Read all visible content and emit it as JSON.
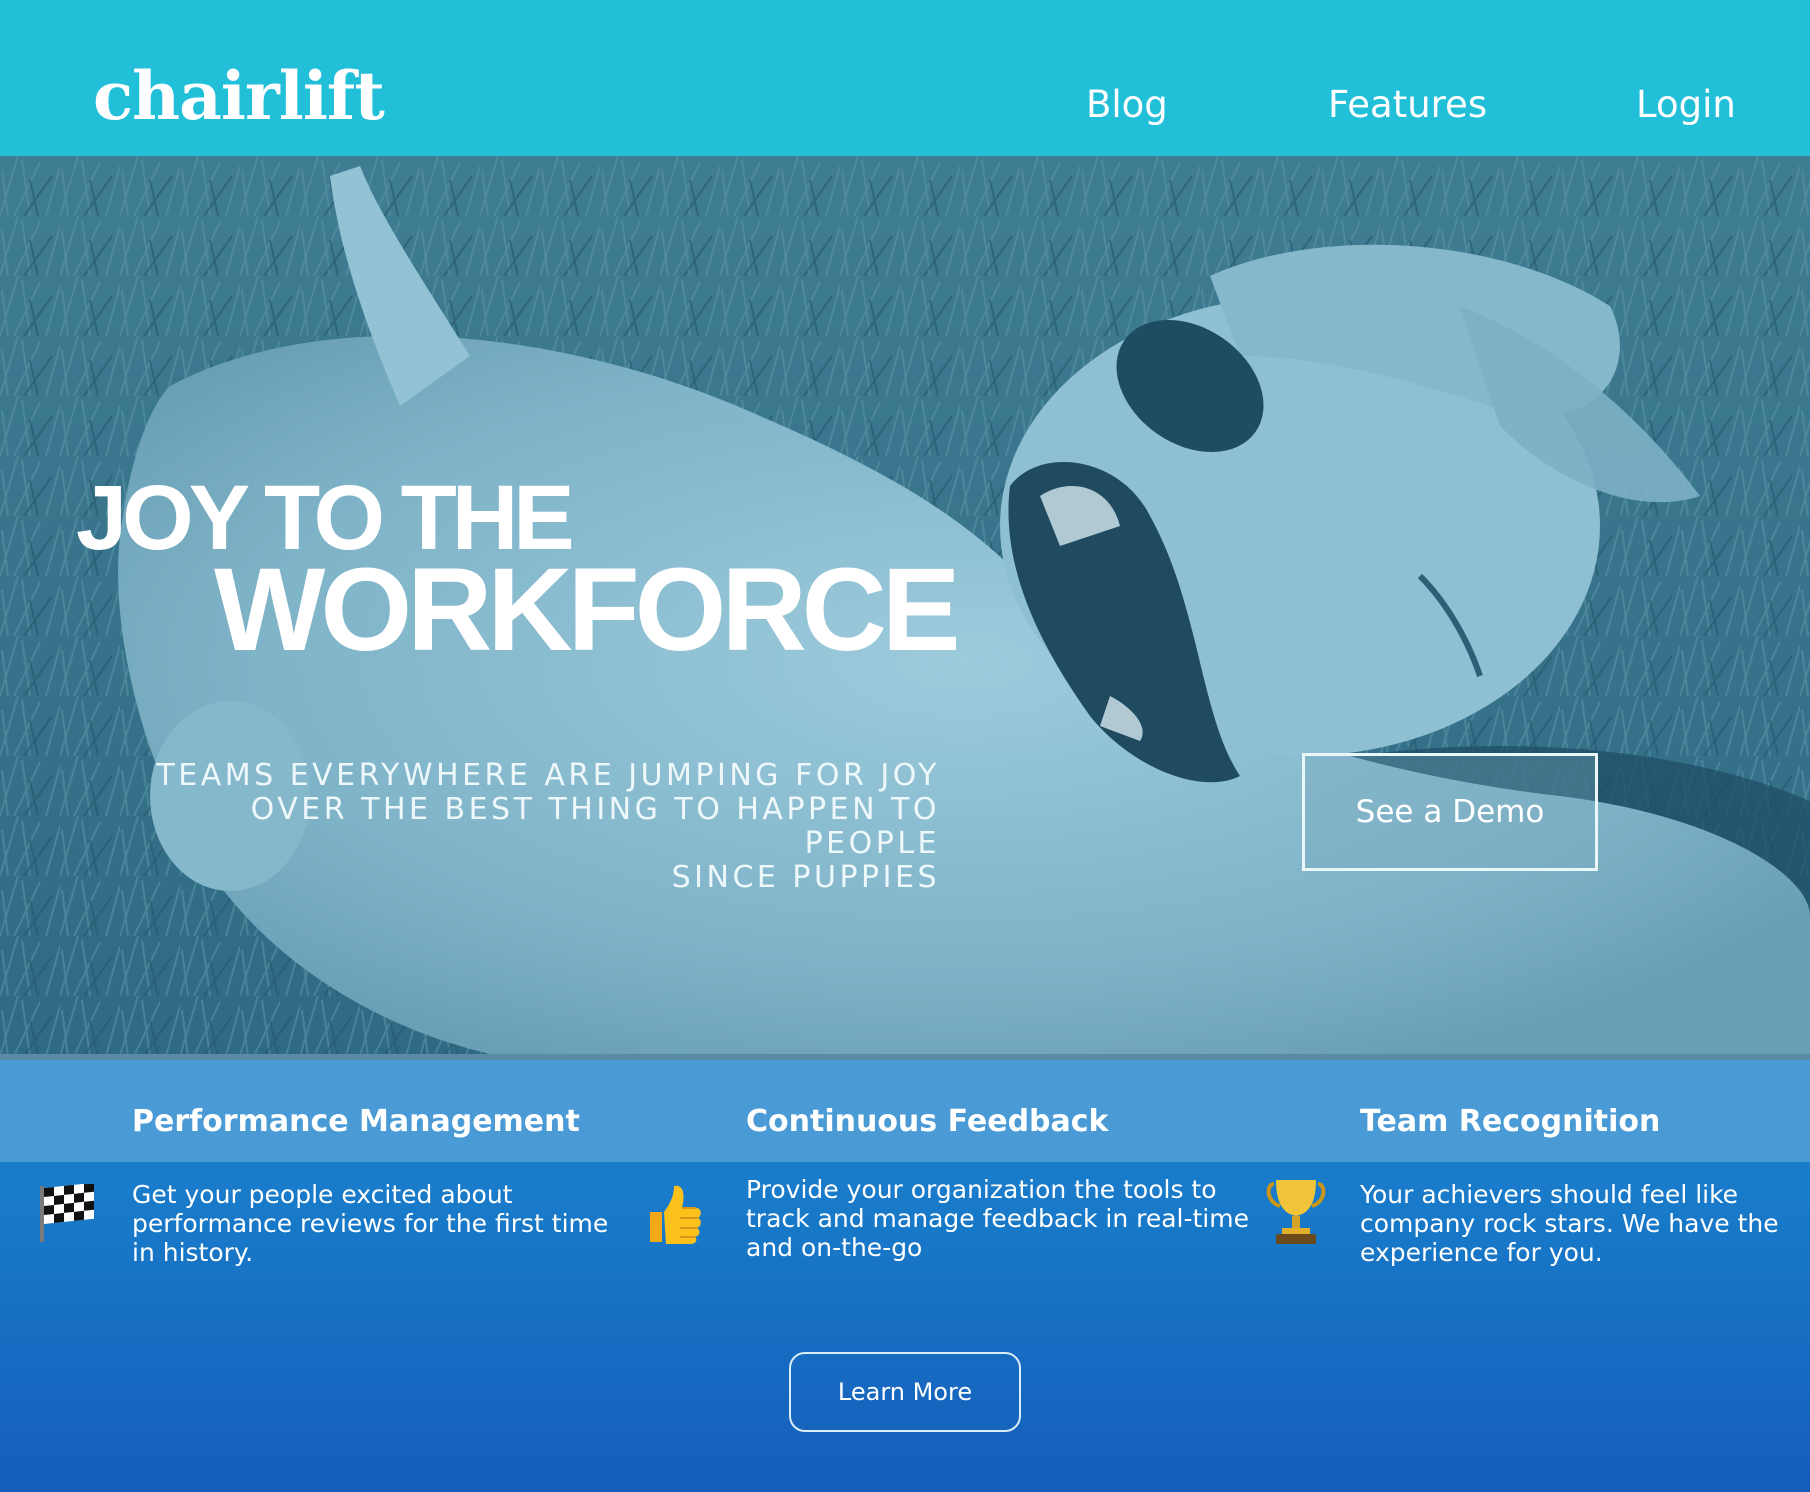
{
  "header": {
    "logo": "chairlift",
    "nav": [
      "Blog",
      "Features",
      "Login"
    ]
  },
  "hero": {
    "title_line1": "JOY TO THE",
    "title_line2": "WORKFORCE",
    "subtitle_lines": [
      "TEAMS EVERYWHERE ARE JUMPING FOR JOY",
      "OVER THE BEST THING TO HAPPEN TO PEOPLE",
      "SINCE PUPPIES"
    ],
    "cta": "See a Demo",
    "image": "puppy-rolling-in-grass"
  },
  "features": {
    "items": [
      {
        "title": "Performance Management",
        "icon": "checkered-flag-icon",
        "lines": [
          "Get your people excited about",
          "performance reviews for the first time",
          "in history."
        ]
      },
      {
        "title": "Continuous Feedback",
        "icon": "thumbs-up-icon",
        "lines": [
          "Provide your organization the tools to",
          "track and manage feedback in real-time",
          "and on-the-go"
        ]
      },
      {
        "title": "Team Recognition",
        "icon": "trophy-icon",
        "lines": [
          "Your achievers should feel like",
          "company rock stars. We have the",
          "experience for you."
        ]
      }
    ],
    "learn_more": "Learn More"
  },
  "colors": {
    "header": "#22bfd9",
    "hero_tint": "#3a7c96",
    "features_band": "#4a9ad6",
    "features_bg_top": "#1b84cd",
    "features_bg_bottom": "#155dba"
  }
}
